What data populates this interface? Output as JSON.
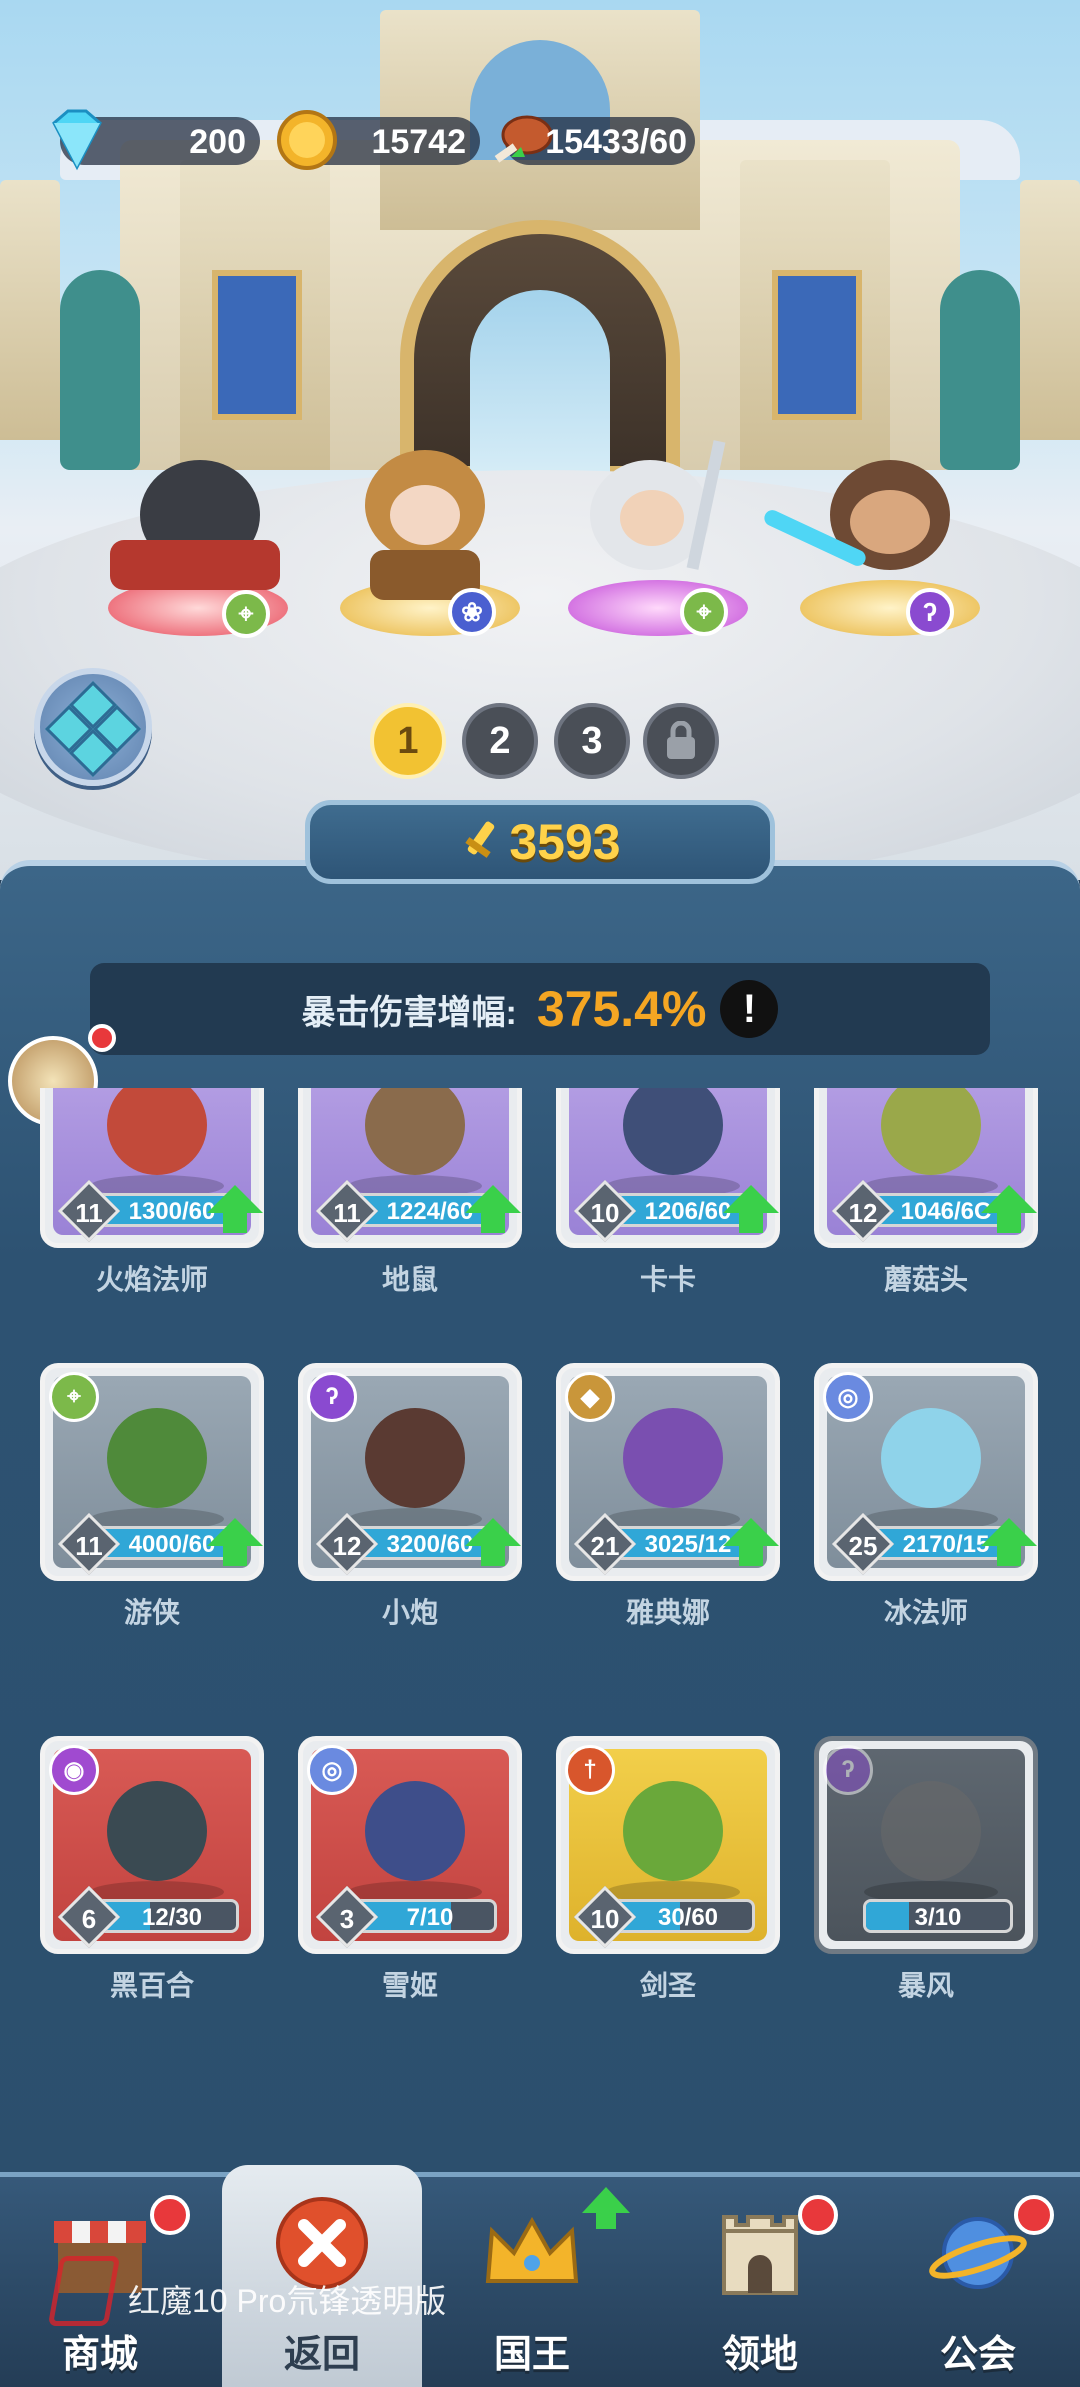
{
  "resources": {
    "gems": "200",
    "gold": "15742",
    "stamina": "15433/60"
  },
  "teams": {
    "tabs": [
      "1",
      "2",
      "3"
    ],
    "active": "1",
    "locked_icon": "lock-icon"
  },
  "power": {
    "value": "3593"
  },
  "crit": {
    "label": "暴击伤害增幅:",
    "value": "375.4%",
    "info": "!"
  },
  "cards": [
    {
      "name": "火焰法师",
      "level": "11",
      "progress": "1300/60",
      "fill": 1.0,
      "upgrade": true,
      "bg": "purple",
      "char_color": "#c24a3a"
    },
    {
      "name": "地鼠",
      "level": "11",
      "progress": "1224/60",
      "fill": 1.0,
      "upgrade": true,
      "bg": "purple",
      "char_color": "#8a6b4c"
    },
    {
      "name": "卡卡",
      "level": "10",
      "progress": "1206/60",
      "fill": 1.0,
      "upgrade": true,
      "bg": "purple",
      "char_color": "#3f4f78"
    },
    {
      "name": "蘑菇头",
      "level": "12",
      "progress": "1046/6C",
      "fill": 1.0,
      "upgrade": true,
      "bg": "purple",
      "char_color": "#9aa84a"
    },
    {
      "name": "游侠",
      "level": "11",
      "progress": "4000/60",
      "fill": 1.0,
      "upgrade": true,
      "bg": "grey",
      "class_icon": "ranger-class-icon",
      "char_color": "#4f8a3a"
    },
    {
      "name": "小炮",
      "level": "12",
      "progress": "3200/60",
      "fill": 1.0,
      "upgrade": true,
      "bg": "grey",
      "class_icon": "mage-class-icon",
      "char_color": "#5a3a32"
    },
    {
      "name": "雅典娜",
      "level": "21",
      "progress": "3025/12",
      "fill": 1.0,
      "upgrade": true,
      "bg": "grey",
      "class_icon": "support-class-icon",
      "char_color": "#7a4fb0"
    },
    {
      "name": "冰法师",
      "level": "25",
      "progress": "2170/15",
      "fill": 1.0,
      "upgrade": true,
      "bg": "grey",
      "class_icon": "ice-class-icon",
      "char_color": "#8fd3ea"
    },
    {
      "name": "黑百合",
      "level": "6",
      "progress": "12/30",
      "fill": 0.4,
      "upgrade": false,
      "bg": "red",
      "class_icon": "assassin-class-icon",
      "char_color": "#3a4a52"
    },
    {
      "name": "雪姬",
      "level": "3",
      "progress": "7/10",
      "fill": 0.7,
      "upgrade": false,
      "bg": "red",
      "class_icon": "ice-class-icon",
      "char_color": "#3e4e8a"
    },
    {
      "name": "剑圣",
      "level": "10",
      "progress": "30/60",
      "fill": 0.5,
      "upgrade": false,
      "bg": "gold",
      "class_icon": "warrior-class-icon",
      "char_color": "#6aa83a"
    },
    {
      "name": "暴风",
      "level": "",
      "progress": "3/10",
      "fill": 0.3,
      "upgrade": false,
      "bg": "locked",
      "class_icon": "mage-class-icon",
      "char_color": "#6a6a6a"
    }
  ],
  "nav": [
    {
      "label": "商城",
      "icon": "shop-icon",
      "badge": true
    },
    {
      "label": "返回",
      "icon": "close-icon",
      "badge": false,
      "active": true
    },
    {
      "label": "国王",
      "icon": "crown-icon",
      "badge": false,
      "upgrade": true
    },
    {
      "label": "领地",
      "icon": "castle-icon",
      "badge": true
    },
    {
      "label": "公会",
      "icon": "planet-icon",
      "badge": true
    }
  ],
  "watermark": "红魔10 Pro氘锋透明版",
  "colors": {
    "power": "#ffd24a",
    "crit_value": "#f5a623",
    "upgrade_arrow": "#3ad04a",
    "badge_red": "#e8383b"
  }
}
